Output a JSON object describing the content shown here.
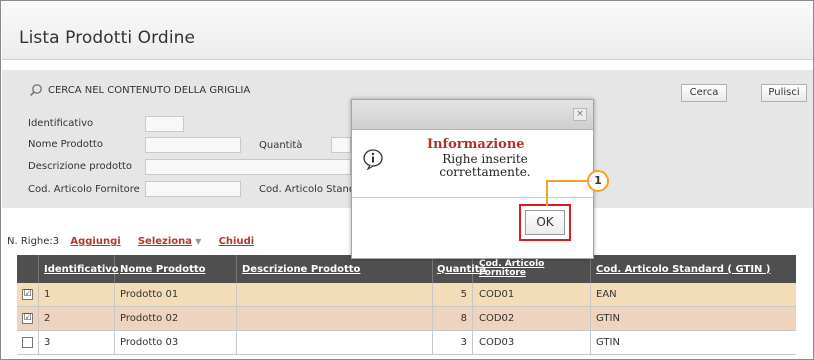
{
  "page": {
    "title": "Lista Prodotti Ordine"
  },
  "search": {
    "heading": "CERCA NEL CONTENUTO DELLA GRIGLIA",
    "fields": {
      "identificativo_label": "Identificativo",
      "nome_label": "Nome Prodotto",
      "quantita_label": "Quantità",
      "descrizione_label": "Descrizione prodotto",
      "cod_fornitore_label": "Cod. Articolo Fornitore",
      "cod_standard_label": "Cod. Articolo Standa"
    },
    "cerca_label": "Cerca",
    "pulisci_label": "Pulisci"
  },
  "toolbar": {
    "rows_label": "N. Righe:",
    "rows_count": "3",
    "aggiungi": "Aggiungi",
    "seleziona": "Seleziona",
    "chiudi": "Chiudi"
  },
  "grid": {
    "columns": [
      "Identificativo",
      "Nome Prodotto",
      "Descrizione Prodotto",
      "Quantità",
      "Cod. Articolo Fornitore",
      "Cod. Articolo Standard ( GTIN )"
    ],
    "rows": [
      {
        "checked": "☑",
        "id": "1",
        "nome": "Prodotto 01",
        "descrizione": "",
        "quantita": "5",
        "cod_fornitore": "COD01",
        "cod_standard": "EAN"
      },
      {
        "checked": "☑",
        "id": "2",
        "nome": "Prodotto 02",
        "descrizione": "",
        "quantita": "8",
        "cod_fornitore": "COD02",
        "cod_standard": "GTIN"
      },
      {
        "checked": "",
        "id": "3",
        "nome": "Prodotto 03",
        "descrizione": "",
        "quantita": "3",
        "cod_fornitore": "COD03",
        "cod_standard": "GTIN"
      }
    ]
  },
  "modal": {
    "title": "Informazione",
    "message": "Righe inserite correttamente.",
    "ok_label": "OK",
    "close_glyph": "×"
  },
  "callout": {
    "number": "1"
  },
  "colors": {
    "row_selected": "#f3ddb9",
    "row_selected_2": "#eed3bf",
    "header_bg": "#4f4f4f",
    "link_red": "#b03a2e",
    "highlight_red": "#d91c1c",
    "callout_orange": "#f2a12a"
  }
}
